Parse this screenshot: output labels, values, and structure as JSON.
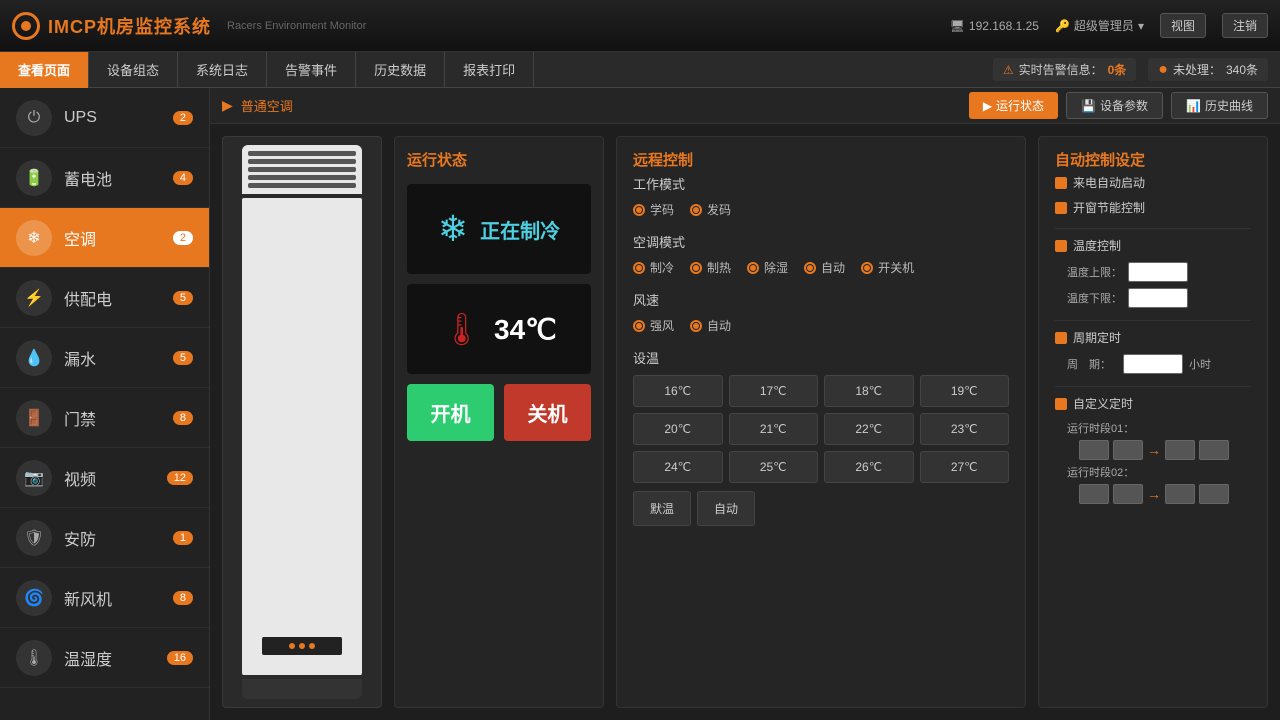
{
  "header": {
    "logo_text": "IMCP机房监控系统",
    "subtitle": "Racers Environment Monitor",
    "ip": "192.168.1.25",
    "user": "超级管理员",
    "view_label": "视图",
    "logout_label": "注销"
  },
  "navbar": {
    "items": [
      {
        "label": "查看页面",
        "active": true
      },
      {
        "label": "设备组态",
        "active": false
      },
      {
        "label": "系统日志",
        "active": false
      },
      {
        "label": "告警事件",
        "active": false
      },
      {
        "label": "历史数据",
        "active": false
      },
      {
        "label": "报表打印",
        "active": false
      }
    ],
    "alert_label": "实时告警信息：",
    "alert_count": "0条",
    "process_label": "未处理：",
    "process_count": "340条"
  },
  "sidebar": {
    "items": [
      {
        "label": "UPS",
        "badge": "2",
        "icon": "⏻",
        "active": false
      },
      {
        "label": "蓄电池",
        "badge": "4",
        "icon": "🔋",
        "active": false
      },
      {
        "label": "空调",
        "badge": "2",
        "icon": "❄",
        "active": true
      },
      {
        "label": "供配电",
        "badge": "5",
        "icon": "⚡",
        "active": false
      },
      {
        "label": "漏水",
        "badge": "5",
        "icon": "💧",
        "active": false
      },
      {
        "label": "门禁",
        "badge": "8",
        "icon": "🚪",
        "active": false
      },
      {
        "label": "视频",
        "badge": "12",
        "icon": "📷",
        "active": false
      },
      {
        "label": "安防",
        "badge": "1",
        "icon": "🛡",
        "active": false
      },
      {
        "label": "新风机",
        "badge": "8",
        "icon": "🌀",
        "active": false
      },
      {
        "label": "温湿度",
        "badge": "16",
        "icon": "🌡",
        "active": false
      }
    ]
  },
  "content": {
    "breadcrumb": "普通空调",
    "toolbar": {
      "run_status": "运行状态",
      "device_params": "设备参数",
      "history_curve": "历史曲线"
    },
    "status_panel": {
      "title": "运行状态",
      "cooling_text": "正在制冷",
      "temperature": "34℃",
      "btn_on": "开机",
      "btn_off": "关机"
    },
    "remote_panel": {
      "title": "远程控制",
      "work_mode_label": "工作模式",
      "work_modes": [
        "学码",
        "发码"
      ],
      "ac_mode_label": "空调模式",
      "ac_modes": [
        "制冷",
        "制热",
        "除湿",
        "自动",
        "开关机"
      ],
      "wind_label": "风速",
      "wind_modes": [
        "强风",
        "自动"
      ],
      "temp_label": "设温",
      "temp_values": [
        "16℃",
        "17℃",
        "18℃",
        "19℃",
        "20℃",
        "21℃",
        "22℃",
        "23℃",
        "24℃",
        "25℃",
        "26℃",
        "27℃"
      ],
      "special_btns": [
        "默温",
        "自动"
      ]
    },
    "auto_panel": {
      "title": "自动控制设定",
      "items": [
        {
          "label": "来电自动启动",
          "checked": true
        },
        {
          "label": "开窗节能控制",
          "checked": true
        }
      ],
      "temp_control_label": "温度控制",
      "temp_upper_label": "温度上限：",
      "temp_lower_label": "温度下限：",
      "timer_label": "周期定时",
      "period_label": "周　期：",
      "period_unit": "小时",
      "self_timer_label": "自定义定时",
      "run_period_01": "运行时段01：",
      "run_period_02": "运行时段02："
    }
  }
}
